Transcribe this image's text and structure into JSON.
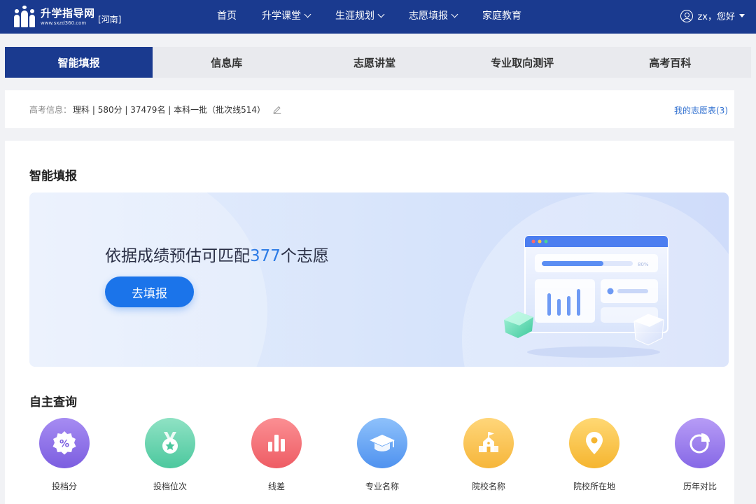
{
  "site": {
    "logo_name": "升学指导网",
    "logo_url": "www.sxzd360.com",
    "region": "[河南]"
  },
  "nav": {
    "items": [
      {
        "label": "首页",
        "dropdown": false
      },
      {
        "label": "升学课堂",
        "dropdown": true
      },
      {
        "label": "生涯规划",
        "dropdown": true
      },
      {
        "label": "志愿填报",
        "dropdown": true
      },
      {
        "label": "家庭教育",
        "dropdown": false
      }
    ],
    "user": "zx，您好"
  },
  "tabs": [
    {
      "label": "智能填报",
      "active": true
    },
    {
      "label": "信息库",
      "active": false
    },
    {
      "label": "志愿讲堂",
      "active": false
    },
    {
      "label": "专业取向测评",
      "active": false
    },
    {
      "label": "高考百科",
      "active": false
    }
  ],
  "info": {
    "label": "高考信息：",
    "value": "理科 | 580分 | 37479名 | 本科一批（批次线514）",
    "my_list": "我的志愿表(3)"
  },
  "smart_fill": {
    "title": "智能填报",
    "headline_before": "依据成绩预估可匹配",
    "headline_number": "377",
    "headline_after": "个志愿",
    "button": "去填报",
    "illustration_progress_label": "80%"
  },
  "self_query": {
    "title": "自主查询",
    "tools": [
      {
        "label": "投档分",
        "icon": "percent-badge-icon",
        "color_top": "#a68cf2",
        "color_bottom": "#7c5ee0"
      },
      {
        "label": "投档位次",
        "icon": "medal-icon",
        "color_top": "#8fe2c4",
        "color_bottom": "#4cc89e"
      },
      {
        "label": "线差",
        "icon": "bar-chart-icon",
        "color_top": "#fb8f93",
        "color_bottom": "#ee5c64"
      },
      {
        "label": "专业名称",
        "icon": "graduation-cap-icon",
        "color_top": "#8ec1fb",
        "color_bottom": "#4f92ef"
      },
      {
        "label": "院校名称",
        "icon": "school-building-icon",
        "color_top": "#ffd67a",
        "color_bottom": "#f6b63a"
      },
      {
        "label": "院校所在地",
        "icon": "location-pin-icon",
        "color_top": "#ffd873",
        "color_bottom": "#f5b530"
      },
      {
        "label": "历年对比",
        "icon": "pie-chart-icon",
        "color_top": "#b79cf6",
        "color_bottom": "#8668e6"
      }
    ]
  },
  "colors": {
    "primary": "#1a3a8f",
    "accent": "#1b74ea",
    "link": "#2f6fd0"
  }
}
